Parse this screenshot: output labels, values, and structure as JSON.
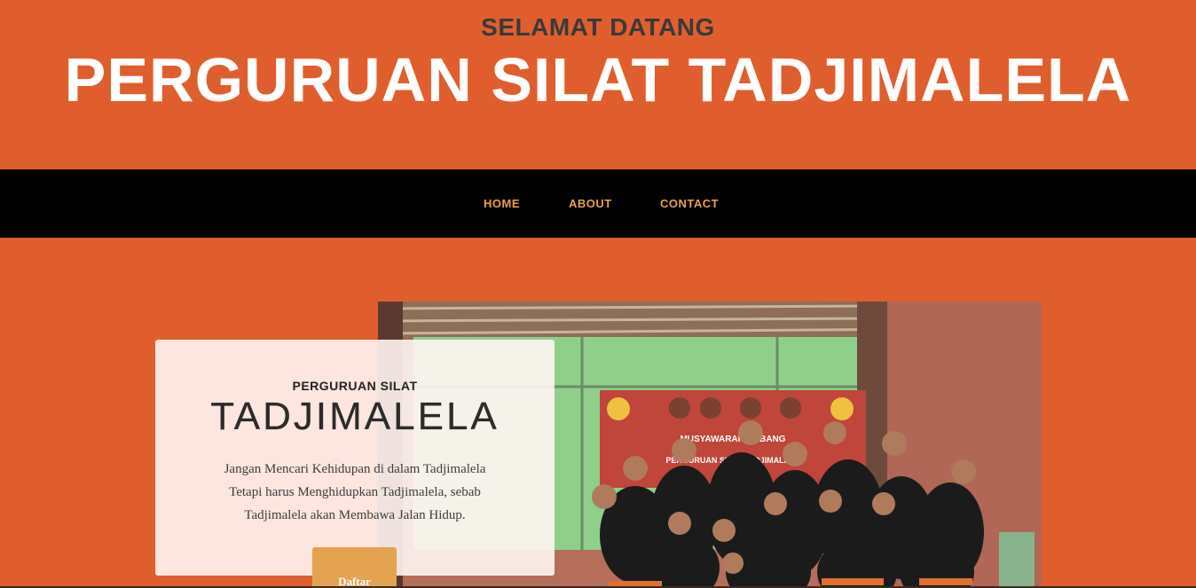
{
  "header": {
    "greeting": "SELAMAT DATANG",
    "title": "PERGURUAN SILAT TADJIMALELA"
  },
  "nav": {
    "items": [
      {
        "label": "HOME"
      },
      {
        "label": "ABOUT"
      },
      {
        "label": "CONTACT"
      }
    ]
  },
  "intro": {
    "subtitle": "PERGURUAN SILAT",
    "title": "TADJIMALELA",
    "quote_lines": [
      "Jangan Mencari Kehidupan di dalam Tadjimalela",
      "Tetapi harus Menghidupkan Tadjimalela, sebab",
      "Tadjimalela akan Membawa Jalan Hidup."
    ],
    "button_label": "Daftar"
  },
  "photo": {
    "banner_text": "MUSYAWARAH CABANG",
    "banner_sub": "PERGURUAN SILAT TADJIMALELA"
  },
  "colors": {
    "brand_orange": "#e05e2d",
    "nav_bg": "#000000",
    "nav_link": "#e8a24a",
    "button": "#e3a350"
  }
}
